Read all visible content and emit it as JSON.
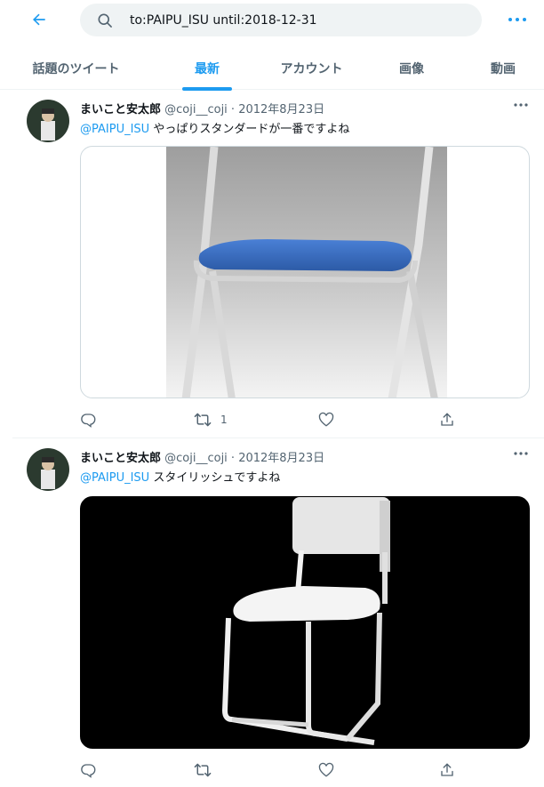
{
  "search": {
    "query": "to:PAIPU_ISU until:2018-12-31"
  },
  "tabs": [
    {
      "label": "話題のツイート"
    },
    {
      "label": "最新"
    },
    {
      "label": "アカウント"
    },
    {
      "label": "画像"
    },
    {
      "label": "動画"
    }
  ],
  "active_tab": "最新",
  "tweets": [
    {
      "display_name": "まいこと安太郎",
      "meta": " @coji__coji · 2012年8月23日",
      "mention": "@PAIPU_ISU",
      "text": " やっぱりスタンダードが一番ですよね",
      "retweet_count": "1"
    },
    {
      "display_name": "まいこと安太郎",
      "meta": " @coji__coji · 2012年8月23日",
      "mention": "@PAIPU_ISU",
      "text": " スタイリッシュですよね",
      "retweet_count": ""
    }
  ],
  "colors": {
    "accent": "#1d9bf0",
    "text_primary": "#0f1419",
    "text_secondary": "#536471",
    "chair_seat_blue": "#3a6fc4"
  },
  "icons": [
    "back-arrow-icon",
    "search-icon",
    "more-icon",
    "reply-icon",
    "retweet-icon",
    "like-icon",
    "share-icon"
  ]
}
